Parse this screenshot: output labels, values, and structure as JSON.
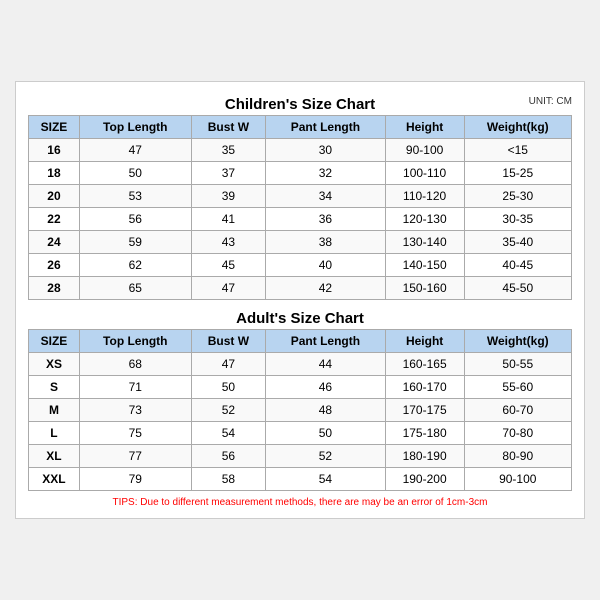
{
  "title": "Children's Size Chart",
  "unit": "UNIT: CM",
  "adults_title": "Adult's Size Chart",
  "tips": "TIPS: Due to different measurement methods, there are may be an error of 1cm-3cm",
  "headers": [
    "SIZE",
    "Top Length",
    "Bust W",
    "Pant Length",
    "Height",
    "Weight(kg)"
  ],
  "children_rows": [
    [
      "16",
      "47",
      "35",
      "30",
      "90-100",
      "<15"
    ],
    [
      "18",
      "50",
      "37",
      "32",
      "100-110",
      "15-25"
    ],
    [
      "20",
      "53",
      "39",
      "34",
      "110-120",
      "25-30"
    ],
    [
      "22",
      "56",
      "41",
      "36",
      "120-130",
      "30-35"
    ],
    [
      "24",
      "59",
      "43",
      "38",
      "130-140",
      "35-40"
    ],
    [
      "26",
      "62",
      "45",
      "40",
      "140-150",
      "40-45"
    ],
    [
      "28",
      "65",
      "47",
      "42",
      "150-160",
      "45-50"
    ]
  ],
  "adult_rows": [
    [
      "XS",
      "68",
      "47",
      "44",
      "160-165",
      "50-55"
    ],
    [
      "S",
      "71",
      "50",
      "46",
      "160-170",
      "55-60"
    ],
    [
      "M",
      "73",
      "52",
      "48",
      "170-175",
      "60-70"
    ],
    [
      "L",
      "75",
      "54",
      "50",
      "175-180",
      "70-80"
    ],
    [
      "XL",
      "77",
      "56",
      "52",
      "180-190",
      "80-90"
    ],
    [
      "XXL",
      "79",
      "58",
      "54",
      "190-200",
      "90-100"
    ]
  ]
}
